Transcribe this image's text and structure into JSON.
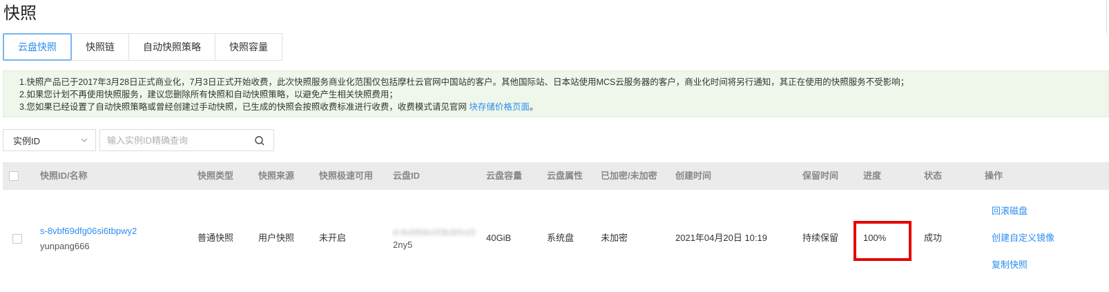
{
  "page": {
    "title": "快照"
  },
  "tabs": [
    {
      "label": "云盘快照",
      "active": true
    },
    {
      "label": "快照链",
      "active": false
    },
    {
      "label": "自动快照策略",
      "active": false
    },
    {
      "label": "快照容量",
      "active": false
    }
  ],
  "notice": {
    "line1": "1.快照产品已于2017年3月28日正式商业化，7月3日正式开始收费，此次快照服务商业化范围仅包括摩杜云官网中国站的客户。其他国际站、日本站使用MCS云服务器的客户，商业化时间将另行通知，其正在使用的快照服务不受影响；",
    "line2": "2.如果您计划不再使用快照服务，建议您删除所有快照和自动快照策略，以避免产生相关快照费用；",
    "line3_prefix": "3.您如果已经设置了自动快照策略或曾经创建过手动快照，已生成的快照会按照收费标准进行收费，收费模式请见官网 ",
    "line3_link": "块存储价格页面",
    "line3_suffix": "。"
  },
  "filter": {
    "select_value": "实例ID",
    "search_placeholder": "输入实例ID精确查询",
    "search_value": ""
  },
  "table": {
    "headers": {
      "name": "快照ID/名称",
      "type": "快照类型",
      "source": "快照来源",
      "fast": "快照极速可用",
      "disk_id": "云盘ID",
      "capacity": "云盘容量",
      "attr": "云盘属性",
      "encrypted": "已加密/未加密",
      "created": "创建时间",
      "retention": "保留时间",
      "progress": "进度",
      "status": "状态",
      "actions": "操作"
    },
    "rows": [
      {
        "id": "s-8vbf69dfg06si6tbpwy2",
        "name": "yunpang666",
        "type": "普通快照",
        "source": "用户快照",
        "fast": "未开启",
        "disk_id_blurred": "d-8vbf69c0f3b3t5rd3",
        "disk_id_tail": "2ny5",
        "capacity": "40GiB",
        "attr": "系统盘",
        "encrypted": "未加密",
        "created": "2021年04月20日 10:19",
        "retention": "持续保留",
        "progress": "100%",
        "status": "成功",
        "actions": [
          "回滚磁盘",
          "创建自定义镜像",
          "复制快照"
        ]
      }
    ]
  },
  "colors": {
    "accent": "#2d8cf0",
    "notice_bg": "#eef7e9",
    "header_bg": "#ebebeb",
    "highlight": "#e60000"
  }
}
